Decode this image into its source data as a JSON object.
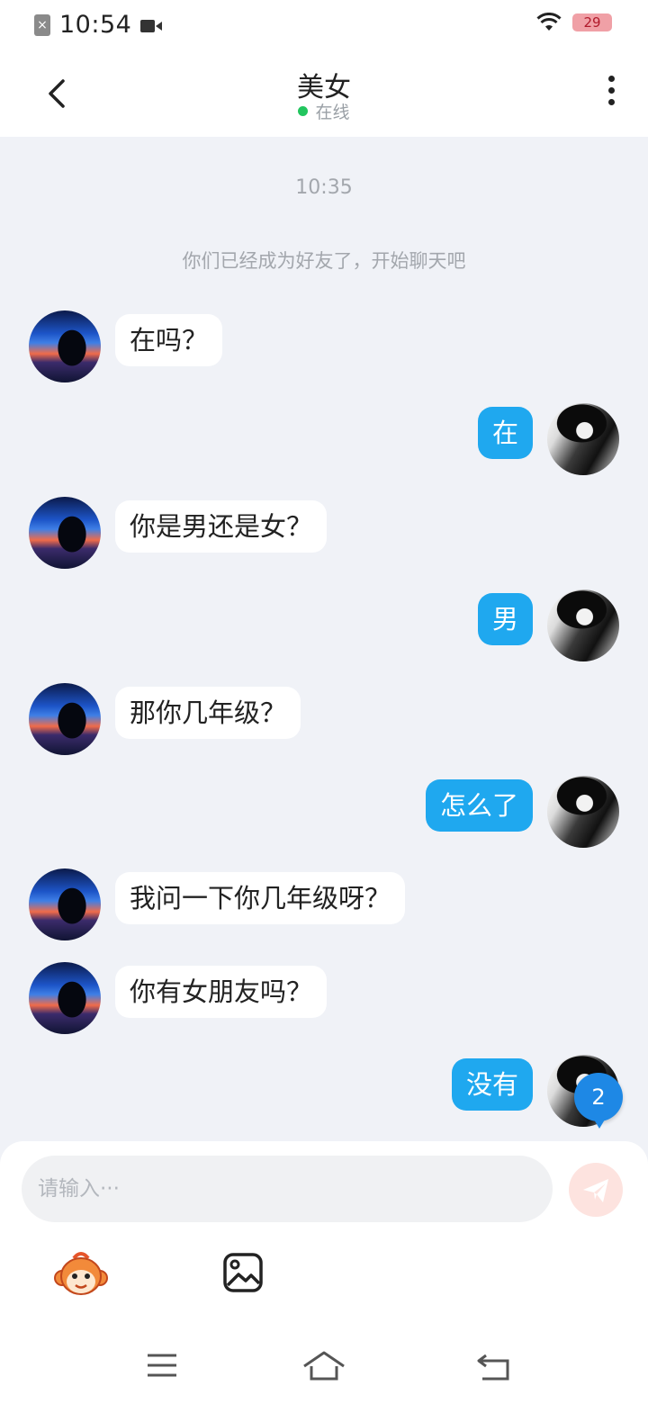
{
  "status_bar": {
    "time": "10:54",
    "battery": "29",
    "icons": [
      "no-sim-icon",
      "video-recording-icon",
      "wifi-icon",
      "battery-icon"
    ]
  },
  "header": {
    "title": "美女",
    "status": "在线",
    "status_color": "#22c55e"
  },
  "chat": {
    "timestamp": "10:35",
    "system_note": "你们已经成为好友了，开始聊天吧",
    "messages": [
      {
        "from": "other",
        "text": "在吗？"
      },
      {
        "from": "self",
        "text": "在"
      },
      {
        "from": "other",
        "text": "你是男还是女？"
      },
      {
        "from": "self",
        "text": "男"
      },
      {
        "from": "other",
        "text": "那你几年级？"
      },
      {
        "from": "self",
        "text": "怎么了"
      },
      {
        "from": "other",
        "text": "我问一下你几年级呀？"
      },
      {
        "from": "other",
        "text": "你有女朋友吗？"
      },
      {
        "from": "self",
        "text": "没有"
      }
    ],
    "unread_count": "2"
  },
  "input": {
    "placeholder": "请输入···",
    "value": ""
  },
  "colors": {
    "self_bubble": "#1fa8ef",
    "other_bubble": "#ffffff",
    "background": "#f0f2f7",
    "send_button": "#fde3df"
  },
  "toolbar": {
    "icons": [
      "monkey-emoji-icon",
      "image-icon"
    ]
  },
  "nav": {
    "icons": [
      "menu-icon",
      "home-icon",
      "back-icon"
    ]
  }
}
